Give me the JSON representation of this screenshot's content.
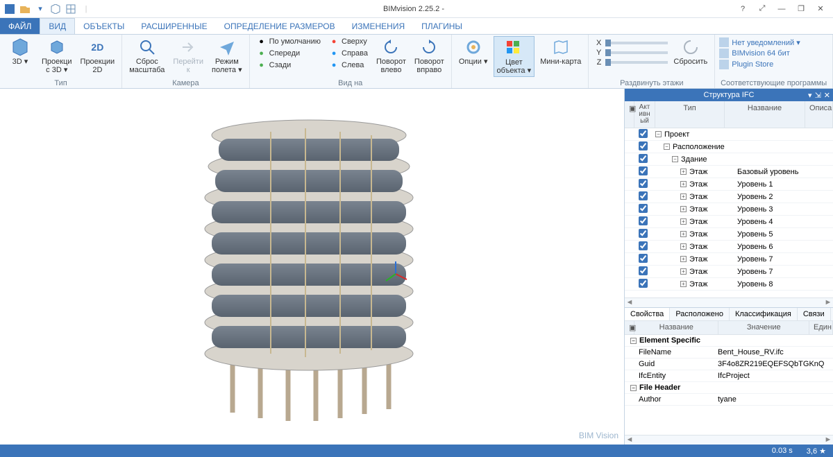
{
  "app": {
    "title": "BIMvision 2.25.2 -",
    "watermark": "BIM Vision"
  },
  "titlebar_buttons": {
    "help": "?",
    "grid": "⤢",
    "min": "—",
    "restore": "❐",
    "close": "✕"
  },
  "tabs": {
    "file": "ФАЙЛ",
    "items": [
      "ВИД",
      "ОБЪЕКТЫ",
      "РАСШИРЕННЫЕ",
      "ОПРЕДЕЛЕНИЕ РАЗМЕРОВ",
      "ИЗМЕНЕНИЯ",
      "ПЛАГИНЫ"
    ],
    "active": 0
  },
  "ribbon": {
    "type": {
      "label": "Тип",
      "btn_3d": "3D ▾",
      "btn_proj3d": "Проекци\nс 3D ▾",
      "btn_proj2d": "Проекции\n2D"
    },
    "camera": {
      "label": "Камера",
      "reset": "Сброс\nмасштаба",
      "goto": "Перейти\nк",
      "flight": "Режим\nполета ▾"
    },
    "view": {
      "label": "Вид на",
      "col1": [
        "По умолчанию",
        "Спереди",
        "Сзади"
      ],
      "col2": [
        "Сверху",
        "Справа",
        "Слева"
      ],
      "rotate_left": "Поворот\nвлево",
      "rotate_right": "Поворот\nвправо"
    },
    "tools": {
      "options": "Опции ▾",
      "color": "Цвет\nобъекта ▾",
      "minimap": "Мини-карта"
    },
    "explode": {
      "label": "Раздвинуть этажи",
      "axes": [
        "X",
        "Y",
        "Z"
      ],
      "reset": "Сбросить"
    },
    "plugins": {
      "label": "Соответствующие программы",
      "items": [
        "Нет уведомлений ▾",
        "BIMvision 64 бит",
        "Plugin Store"
      ]
    }
  },
  "tree": {
    "title": "Структура IFC",
    "columns": {
      "active": "Акт\nивн\nый",
      "type": "Тип",
      "name": "Название",
      "desc": "Описа"
    },
    "rows": [
      {
        "indent": 0,
        "exp": "−",
        "type": "Проект",
        "name": ""
      },
      {
        "indent": 1,
        "exp": "−",
        "type": "Расположение",
        "name": ""
      },
      {
        "indent": 2,
        "exp": "−",
        "type": "Здание",
        "name": ""
      },
      {
        "indent": 3,
        "exp": "+",
        "type": "Этаж",
        "name": "Базовый уровень"
      },
      {
        "indent": 3,
        "exp": "+",
        "type": "Этаж",
        "name": "Уровень 1"
      },
      {
        "indent": 3,
        "exp": "+",
        "type": "Этаж",
        "name": "Уровень 2"
      },
      {
        "indent": 3,
        "exp": "+",
        "type": "Этаж",
        "name": "Уровень 3"
      },
      {
        "indent": 3,
        "exp": "+",
        "type": "Этаж",
        "name": "Уровень 4"
      },
      {
        "indent": 3,
        "exp": "+",
        "type": "Этаж",
        "name": "Уровень 5"
      },
      {
        "indent": 3,
        "exp": "+",
        "type": "Этаж",
        "name": "Уровень 6"
      },
      {
        "indent": 3,
        "exp": "+",
        "type": "Этаж",
        "name": "Уровень 7"
      },
      {
        "indent": 3,
        "exp": "+",
        "type": "Этаж",
        "name": "Уровень 7"
      },
      {
        "indent": 3,
        "exp": "+",
        "type": "Этаж",
        "name": "Уровень 8"
      }
    ]
  },
  "props": {
    "tabs": [
      "Свойства",
      "Расположено",
      "Классификация",
      "Связи"
    ],
    "columns": {
      "name": "Название",
      "value": "Значение",
      "unit": "Един"
    },
    "rows": [
      {
        "group": true,
        "name": "Element Specific",
        "value": ""
      },
      {
        "name": "FileName",
        "value": "Bent_House_RV.ifc"
      },
      {
        "name": "Guid",
        "value": "3F4o8ZR219EQEFSQbTGKnQ"
      },
      {
        "name": "IfcEntity",
        "value": "IfcProject"
      },
      {
        "group": true,
        "name": "File Header",
        "value": ""
      },
      {
        "name": "Author",
        "value": "tyane"
      }
    ]
  },
  "status": {
    "time": "0.03 s",
    "stars": "3,6 ★"
  }
}
